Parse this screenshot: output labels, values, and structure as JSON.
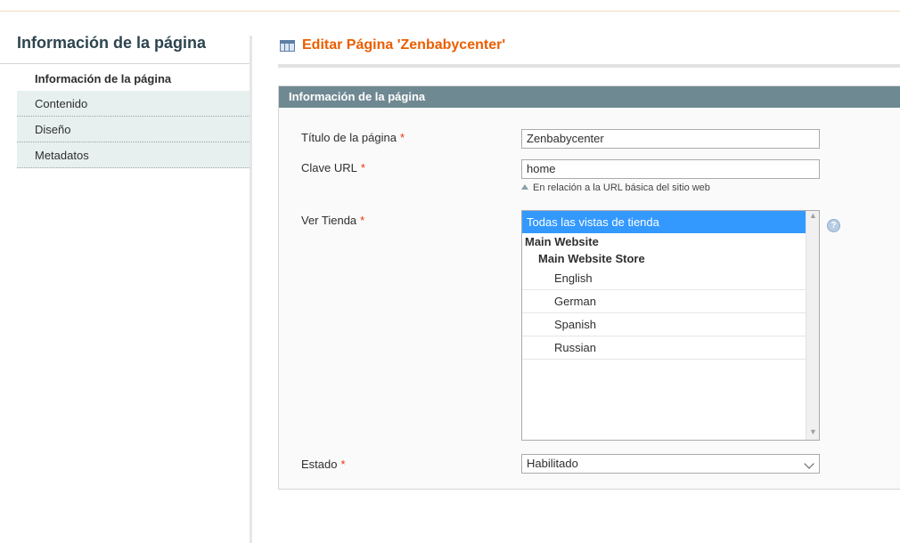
{
  "sidebar": {
    "title": "Información de la página",
    "tabs": [
      {
        "label": "Información de la página"
      },
      {
        "label": "Contenido"
      },
      {
        "label": "Diseño"
      },
      {
        "label": "Metadatos"
      }
    ]
  },
  "header": {
    "title": "Editar Página 'Zenbabycenter'",
    "icon": "grid-icon"
  },
  "panel": {
    "heading": "Información de la página"
  },
  "form": {
    "required_mark": "*",
    "title": {
      "label": "Título de la página",
      "value": "Zenbabycenter"
    },
    "url_key": {
      "label": "Clave URL",
      "value": "home",
      "note": "En relación a la URL básica del sitio web"
    },
    "store_view": {
      "label": "Ver Tienda",
      "selected": "Todas las vistas de tienda",
      "website": "Main Website",
      "store": "Main Website Store",
      "views": [
        "English",
        "German",
        "Spanish",
        "Russian"
      ],
      "help_glyph": "?"
    },
    "status": {
      "label": "Estado",
      "value": "Habilitado"
    }
  },
  "colors": {
    "accent": "#eb5e00",
    "panel_header": "#6f8992",
    "selected_option": "#3399ff",
    "required": "#eb340a",
    "tab_bg": "#e7efef"
  }
}
